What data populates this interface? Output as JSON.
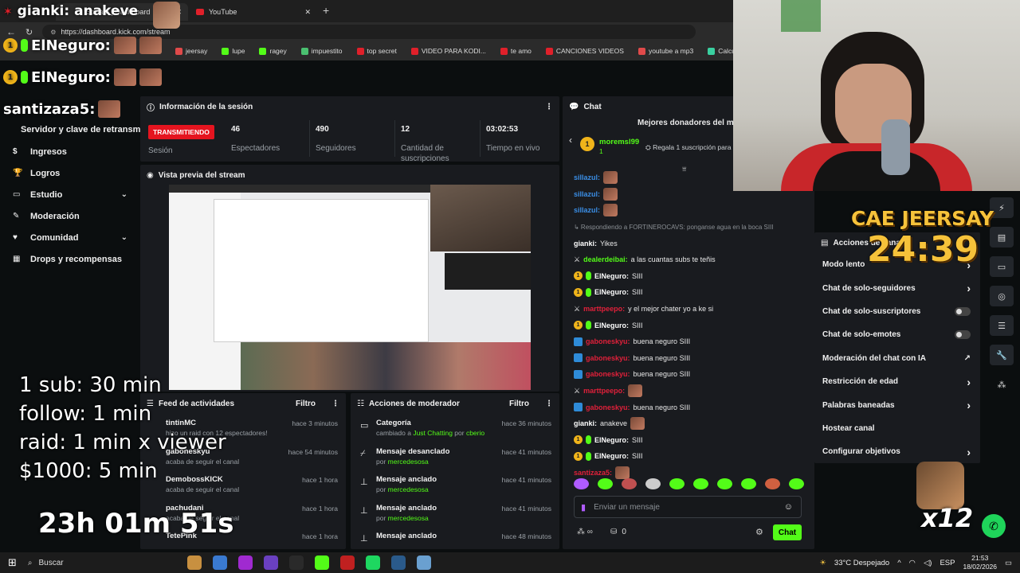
{
  "overlay": {
    "streamer_name": "gianki: anakeve",
    "chat_pop_1": "ElNeguro:",
    "chat_pop_2": "ElNeguro:",
    "chat_pop_3": "santizaza5:",
    "subathon_rules": [
      "1 sub: 30 min",
      "follow: 1 min",
      "raid: 1 min x viewer",
      "$1000: 5 min"
    ],
    "timer_main": "23h 01m 51s",
    "cam_title": "CAE JEERSAY",
    "cam_timer": "24:39",
    "emote_count": "x12"
  },
  "browser": {
    "tabs": [
      {
        "label": "Stream | Dashboard"
      },
      {
        "label": "YouTube"
      }
    ],
    "url": "https://dashboard.kick.com/stream",
    "bookmarks": [
      {
        "label": "jeersay",
        "color": "#e04a4a"
      },
      {
        "label": "lupe",
        "color": "#53fc18"
      },
      {
        "label": "ragey",
        "color": "#53fc18"
      },
      {
        "label": "impuestito",
        "color": "#4ac070"
      },
      {
        "label": "top secret",
        "color": "#e0202a"
      },
      {
        "label": "VIDEO PARA KODI...",
        "color": "#e0202a"
      },
      {
        "label": "te amo",
        "color": "#e0202a"
      },
      {
        "label": "CANCIONES VIDEOS",
        "color": "#e0202a"
      },
      {
        "label": "youtube a mp3",
        "color": "#e04a4a"
      },
      {
        "label": "Calculadora De Su...",
        "color": "#3ad0a0"
      }
    ]
  },
  "sidebar": {
    "top_label": "Servidor y clave de retransmisión",
    "items": [
      {
        "label": "Ingresos",
        "icon": "dollar-icon"
      },
      {
        "label": "Logros",
        "icon": "trophy-icon"
      },
      {
        "label": "Estudio",
        "icon": "studio-icon"
      },
      {
        "label": "Moderación",
        "icon": "wrench-icon"
      },
      {
        "label": "Comunidad",
        "icon": "community-icon"
      },
      {
        "label": "Drops y recompensas",
        "icon": "drops-icon"
      }
    ]
  },
  "session": {
    "title": "Información de la sesión",
    "status": "TRANSMITIENDO",
    "status_label": "Sesión",
    "stats": [
      {
        "value": "46",
        "label": "Espectadores"
      },
      {
        "value": "490",
        "label": "Seguidores"
      },
      {
        "value": "12",
        "label": "Cantidad de suscripciones"
      },
      {
        "value": "03:02:53",
        "label": "Tiempo en vivo"
      }
    ]
  },
  "preview": {
    "title": "Vista previa del stream"
  },
  "feed": {
    "title": "Feed de actividades",
    "filter_label": "Filtro",
    "items": [
      {
        "name": "tintinMC",
        "detail": "hizo un raid con 12 espectadores!",
        "time": "hace 3 minutos"
      },
      {
        "name": "gaboneskyu",
        "detail": "acaba de seguir el canal",
        "time": "hace 54 minutos"
      },
      {
        "name": "DemobossKICK",
        "detail": "acaba de seguir el canal",
        "time": "hace 1 hora"
      },
      {
        "name": "pachudani",
        "detail": "acaba de seguir el canal",
        "time": "hace 1 hora"
      },
      {
        "name": "TetePink",
        "detail": "",
        "time": "hace 1 hora"
      }
    ]
  },
  "modactions": {
    "title": "Acciones de moderador",
    "filter_label": "Filtro",
    "items": [
      {
        "title": "Categoría",
        "pre": "cambiado a ",
        "highlight": "Just Chatting",
        "mid": " por ",
        "user": "cberio",
        "time": "hace 36 minutos",
        "icon": "category-icon"
      },
      {
        "title": "Mensaje desanclado",
        "pre": "por ",
        "highlight": "",
        "mid": "",
        "user": "mercedesosa",
        "time": "hace 41 minutos",
        "icon": "unpin-icon"
      },
      {
        "title": "Mensaje anclado",
        "pre": "por ",
        "highlight": "",
        "mid": "",
        "user": "mercedesosa",
        "time": "hace 41 minutos",
        "icon": "pin-icon"
      },
      {
        "title": "Mensaje anclado",
        "pre": "por ",
        "highlight": "",
        "mid": "",
        "user": "mercedesosa",
        "time": "hace 41 minutos",
        "icon": "pin-icon"
      },
      {
        "title": "Mensaje anclado",
        "pre": "",
        "highlight": "",
        "mid": "",
        "user": "",
        "time": "hace 48 minutos",
        "icon": "pin-icon"
      }
    ]
  },
  "chat": {
    "title": "Chat",
    "top_donors": "Mejores donadores del mes",
    "donor_name": "moremsl99",
    "donor_amount": "1",
    "gift_text": "Regala 1 suscripción para",
    "messages": [
      {
        "user": "sillazul:",
        "color": "#3a8ee6",
        "text": "",
        "emote": true,
        "badges": ""
      },
      {
        "user": "sillazul:",
        "color": "#3a8ee6",
        "text": "",
        "emote": true,
        "badges": ""
      },
      {
        "user": "sillazul:",
        "color": "#3a8ee6",
        "text": "",
        "emote": true,
        "badges": ""
      },
      {
        "user": "↳ Respondiendo a FORTINEROCAVS: ponganse agua en la boca SIII",
        "color": "#8a8f94",
        "text": "",
        "emote": false,
        "badges": "reply"
      },
      {
        "user": "gianki:",
        "color": "#ffffff",
        "text": "Yikes",
        "emote": false,
        "badges": ""
      },
      {
        "user": "dealerdeibai:",
        "color": "#53fc18",
        "text": "a las cuantas subs te teñis",
        "emote": false,
        "badges": "sword"
      },
      {
        "user": "ElNeguro:",
        "color": "#ffffff",
        "text": "SIII",
        "emote": false,
        "badges": "gold"
      },
      {
        "user": "ElNeguro:",
        "color": "#ffffff",
        "text": "SIII",
        "emote": false,
        "badges": "gold"
      },
      {
        "user": "marttpeepo:",
        "color": "#e0203a",
        "text": "y el mejor chater yo a ke si",
        "emote": false,
        "badges": "sword"
      },
      {
        "user": "ElNeguro:",
        "color": "#ffffff",
        "text": "SIII",
        "emote": false,
        "badges": "gold"
      },
      {
        "user": "gaboneskyu:",
        "color": "#e0203a",
        "text": "buena neguro SIII",
        "emote": false,
        "badges": "blue"
      },
      {
        "user": "gaboneskyu:",
        "color": "#e0203a",
        "text": "buena neguro SIII",
        "emote": false,
        "badges": "blue"
      },
      {
        "user": "gaboneskyu:",
        "color": "#e0203a",
        "text": "buena neguro SIII",
        "emote": false,
        "badges": "blue"
      },
      {
        "user": "marttpeepo:",
        "color": "#e0203a",
        "text": "",
        "emote": true,
        "badges": "sword"
      },
      {
        "user": "gaboneskyu:",
        "color": "#e0203a",
        "text": "buena neguro SIII",
        "emote": false,
        "badges": "blue"
      },
      {
        "user": "gianki:",
        "color": "#ffffff",
        "text": "anakeve",
        "emote": true,
        "badges": ""
      },
      {
        "user": "ElNeguro:",
        "color": "#ffffff",
        "text": "SIII",
        "emote": false,
        "badges": "gold"
      },
      {
        "user": "ElNeguro:",
        "color": "#ffffff",
        "text": "SIII",
        "emote": false,
        "badges": "gold"
      },
      {
        "user": "santizaza5:",
        "color": "#e0203a",
        "text": "",
        "emote": true,
        "badges": ""
      }
    ],
    "input_placeholder": "Enviar un mensaje",
    "points": "0",
    "send_label": "Chat"
  },
  "actions": {
    "title": "Acciones de canal",
    "items": [
      {
        "label": "Modo lento",
        "control": "chevron"
      },
      {
        "label": "Chat de solo-seguidores",
        "control": "chevron"
      },
      {
        "label": "Chat de solo-suscriptores",
        "control": "toggle"
      },
      {
        "label": "Chat de solo-emotes",
        "control": "toggle"
      },
      {
        "label": "Moderación del chat con IA",
        "control": "external"
      },
      {
        "label": "Restricción de edad",
        "control": "chevron"
      },
      {
        "label": "Palabras baneadas",
        "control": "chevron"
      },
      {
        "label": "Hostear canal",
        "control": "none"
      },
      {
        "label": "Configurar objetivos",
        "control": "chevron"
      }
    ]
  },
  "taskbar": {
    "search_label": "Buscar",
    "weather": "33°C  Despejado",
    "lang": "ESP",
    "time": "21:53",
    "date": "18/02/2026"
  },
  "colors": {
    "kick_green": "#53fc18",
    "live_red": "#e5141f",
    "panel": "#191b1f"
  }
}
